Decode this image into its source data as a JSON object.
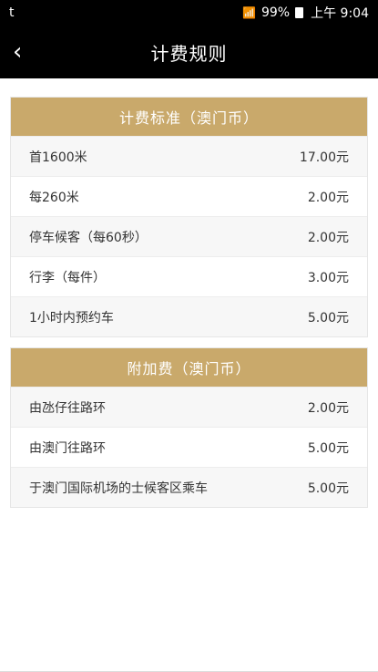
{
  "status_bar": {
    "left_text": "t",
    "signal_icons": "📶",
    "battery_percent": "99%",
    "time": "上午 9:04"
  },
  "header": {
    "title": "计费规则",
    "back_symbol": "‹"
  },
  "sections": {
    "standard": {
      "title": "计费标准（澳门币）",
      "rows": [
        {
          "label": "首1600米",
          "value": "17.00元"
        },
        {
          "label": "每260米",
          "value": "2.00元"
        },
        {
          "label": "停车候客（每60秒）",
          "value": "2.00元"
        },
        {
          "label": "行李（每件）",
          "value": "3.00元"
        },
        {
          "label": "1小时内预约车",
          "value": "5.00元"
        }
      ]
    },
    "surcharge": {
      "title": "附加费（澳门币）",
      "rows": [
        {
          "label": "由氹仔往路环",
          "value": "2.00元"
        },
        {
          "label": "由澳门往路环",
          "value": "5.00元"
        },
        {
          "label": "于澳门国际机场的士候客区乘车",
          "value": "5.00元"
        }
      ]
    }
  },
  "colors": {
    "accent_gold": "#c9a96b",
    "header_bg": "#000000",
    "status_bg": "#000000"
  }
}
